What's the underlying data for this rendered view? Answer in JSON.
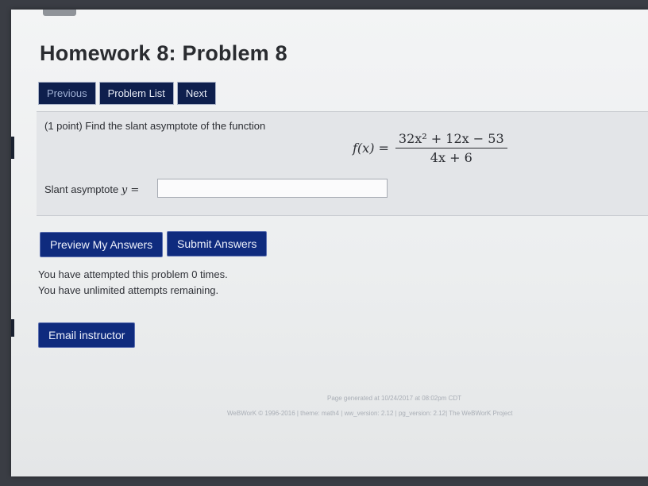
{
  "page": {
    "title": "Homework 8: Problem 8"
  },
  "nav": {
    "previous": "Previous",
    "problem_list": "Problem List",
    "next": "Next"
  },
  "problem": {
    "prompt": "(1 point) Find the slant asymptote of the function",
    "formula_lhs": "f(x) =",
    "numerator": "32x² + 12x − 53",
    "denominator": "4x + 6",
    "answer_label": "Slant asymptote",
    "answer_var": "y =",
    "answer_value": ""
  },
  "actions": {
    "preview": "Preview My Answers",
    "submit": "Submit Answers",
    "email": "Email instructor"
  },
  "status": {
    "attempts": "You have attempted this problem 0 times.",
    "remaining": "You have unlimited attempts remaining."
  },
  "footer": {
    "generated": "Page generated at 10/24/2017 at 08:02pm CDT",
    "credits": "WeBWorK © 1996-2016 | theme: math4 | ww_version: 2.12 | pg_version: 2.12| The WeBWorK Project"
  },
  "colors": {
    "button_bg": "#0f2b7e",
    "nav_bg": "#0e1f4d",
    "panel_bg": "#e3e5e8"
  }
}
